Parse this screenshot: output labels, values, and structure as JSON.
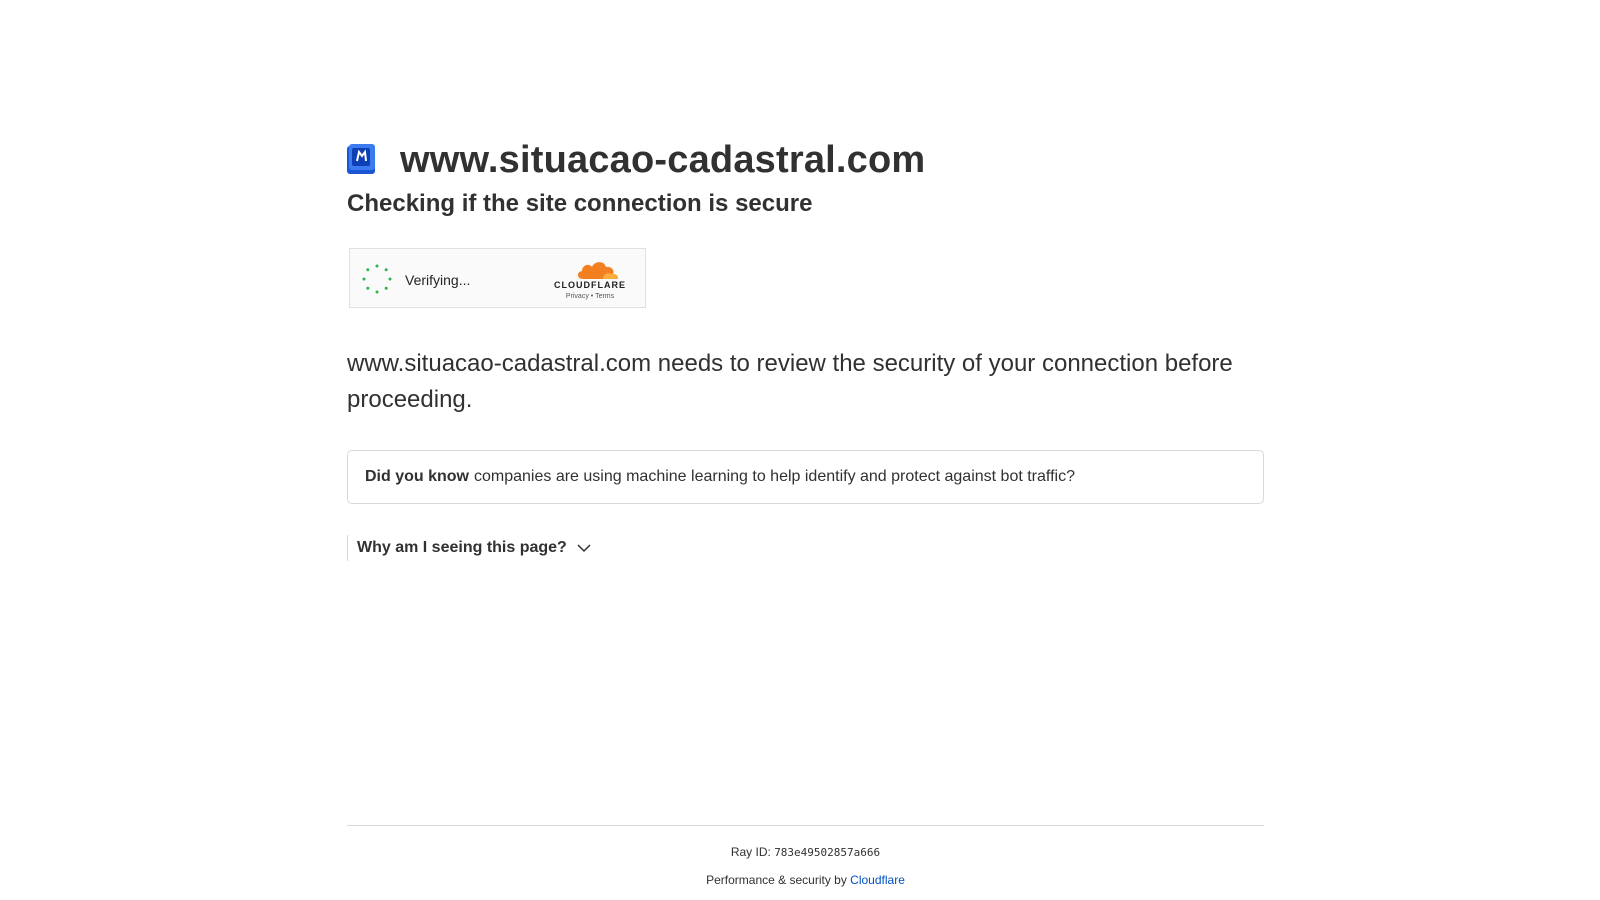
{
  "header": {
    "site_name": "www.situacao-cadastral.com",
    "subtitle": "Checking if the site connection is secure",
    "favicon": "site-favicon-blue-icon"
  },
  "widget": {
    "status": "Verifying...",
    "brand": "CLOUDFLARE",
    "privacy": "Privacy",
    "separator": "•",
    "terms": "Terms",
    "spinner_color": "#2cb54a",
    "cloud_color": "#f38020"
  },
  "review": {
    "text": "www.situacao-cadastral.com needs to review the security of your connection before proceeding."
  },
  "did_you_know": {
    "lead": "Did you know",
    "text": "companies are using machine learning to help identify and protect against bot traffic?"
  },
  "why": {
    "label": "Why am I seeing this page?"
  },
  "footer": {
    "ray_label": "Ray ID:",
    "ray_id": "783e49502857a666",
    "perf_text": "Performance & security by",
    "perf_link": "Cloudflare",
    "link_color": "#0051c3"
  }
}
